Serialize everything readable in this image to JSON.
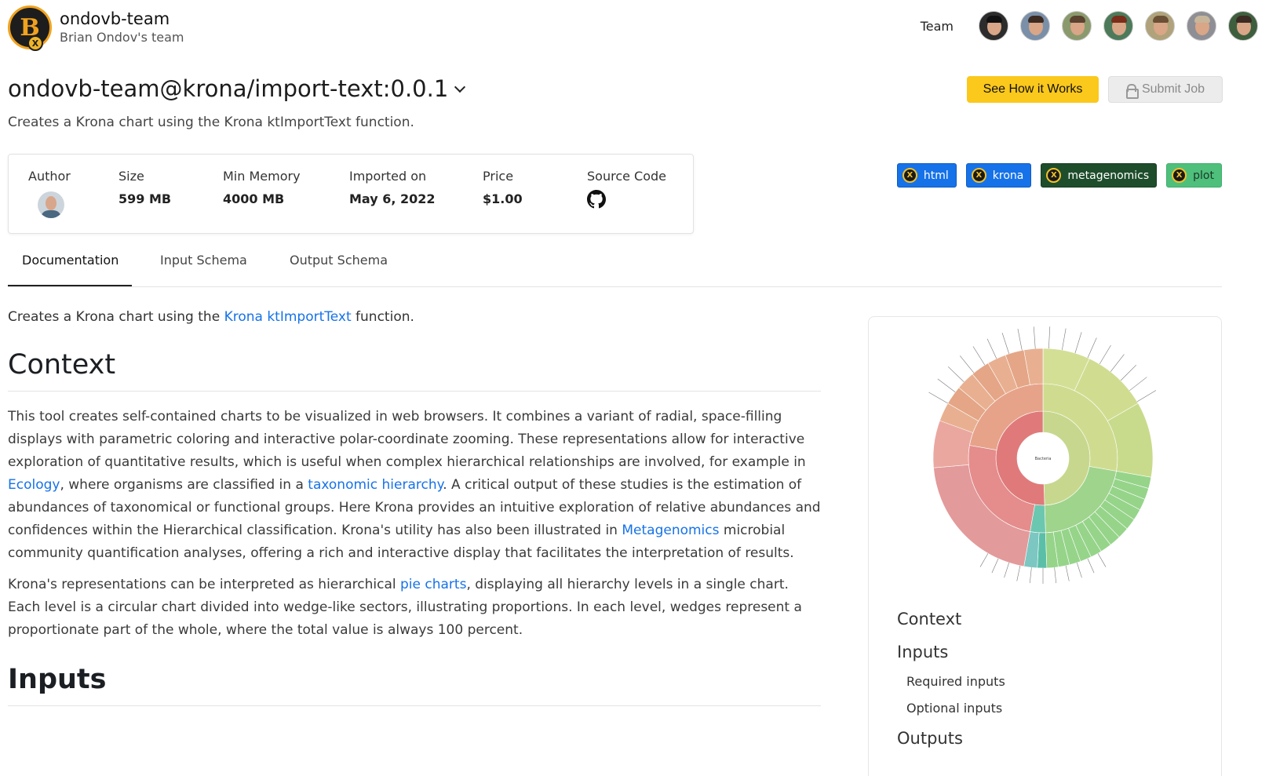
{
  "team": {
    "name": "ondovb-team",
    "subtitle": "Brian Ondov's team",
    "logo_letter": "B",
    "logo_badge": "X"
  },
  "members": {
    "label": "Team",
    "count": 7
  },
  "job": {
    "title": "ondovb-team@krona/import-text:0.0.1",
    "description": "Creates a Krona chart using the Krona ktImportText function."
  },
  "buttons": {
    "how": "See How it Works",
    "submit": "Submit Job"
  },
  "info": {
    "author_label": "Author",
    "size_label": "Size",
    "size_value": "599 MB",
    "memory_label": "Min Memory",
    "memory_value": "4000 MB",
    "imported_label": "Imported on",
    "imported_value": "May 6, 2022",
    "price_label": "Price",
    "price_value": "$1.00",
    "source_label": "Source Code"
  },
  "tags": [
    {
      "label": "html",
      "badge": "X"
    },
    {
      "label": "krona",
      "badge": "X"
    },
    {
      "label": "metagenomics",
      "badge": "X"
    },
    {
      "label": "plot",
      "badge": "X"
    }
  ],
  "tabs": [
    "Documentation",
    "Input Schema",
    "Output Schema"
  ],
  "doc": {
    "lead_pre": "Creates a Krona chart using the ",
    "lead_link": "Krona ktImportText",
    "lead_post": " function.",
    "context_heading": "Context",
    "p1_a": "This tool creates self-contained charts to be visualized in web browsers. It combines a variant of radial, space-filling displays with parametric coloring and interactive polar-coordinate zooming. These representations allow for interactive exploration of quantitative results, which is useful when complex hierarchical relationships are involved, for example in ",
    "p1_link1": "Ecology",
    "p1_b": ", where organisms are classified in a ",
    "p1_link2": "taxonomic hierarchy",
    "p1_c": ". A critical output of these studies is the estimation of abundances of taxonomical or functional groups. Here Krona provides an intuitive exploration of relative abundances and confidences within the Hierarchical classification. Krona's utility has also been illustrated in ",
    "p1_link3": "Metagenomics",
    "p1_d": " microbial community quantification analyses, offering a rich and interactive display that facilitates the interpretation of results.",
    "p2_a": "Krona's representations can be interpreted as hierarchical ",
    "p2_link": "pie charts",
    "p2_b": ", displaying all hierarchy levels in a single chart. Each level is a circular chart divided into wedge-like sectors, illustrating proportions. In each level, wedges represent a proportionate part of the whole, where the total value is always 100 percent.",
    "inputs_heading": "Inputs"
  },
  "toc": {
    "context": "Context",
    "inputs": "Inputs",
    "required": "Required inputs",
    "optional": "Optional inputs",
    "outputs": "Outputs"
  },
  "krona": {
    "center_label": "Bacteria"
  }
}
